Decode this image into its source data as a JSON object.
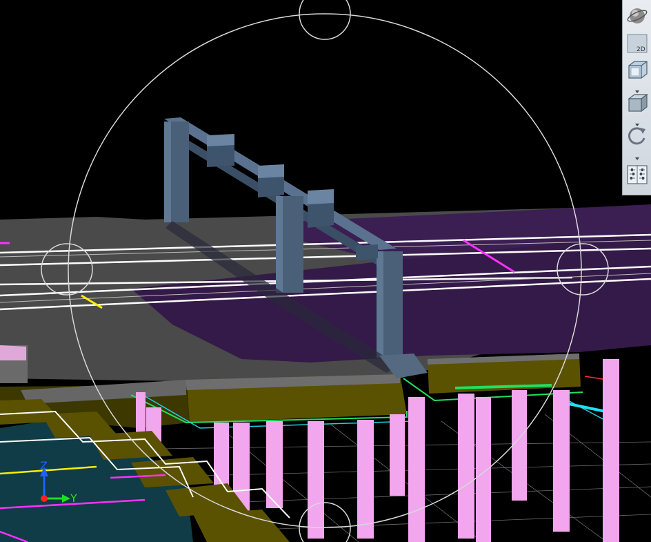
{
  "viewport": {
    "background": "#000000",
    "colors": {
      "slab_grey": "#4a4a4a",
      "slab_purple": "#3a1f4a",
      "pier_steel": "#3e556e",
      "pile_pink": "#f2a6ee",
      "ground_olive": "#5a5200",
      "panel_teal": "#0f3c46"
    }
  },
  "axis_triad": {
    "z_label": "Z",
    "y_label": "Y",
    "z_color": "#2060ff",
    "y_color": "#20dd20",
    "origin_color": "#ff2020"
  },
  "toolbar": {
    "buttons": [
      {
        "name": "orbit-sphere-button",
        "icon": "globe-icon"
      },
      {
        "name": "view-2d-button",
        "icon": "view-2d-icon",
        "label": "2D"
      },
      {
        "name": "view-cube-button",
        "icon": "wireframe-cube-icon"
      },
      {
        "name": "shaded-cube-button",
        "icon": "solid-cube-icon"
      },
      {
        "name": "rotate-button",
        "icon": "rotate-icon"
      },
      {
        "name": "view-settings-button",
        "icon": "settings-panel-icon"
      }
    ]
  }
}
